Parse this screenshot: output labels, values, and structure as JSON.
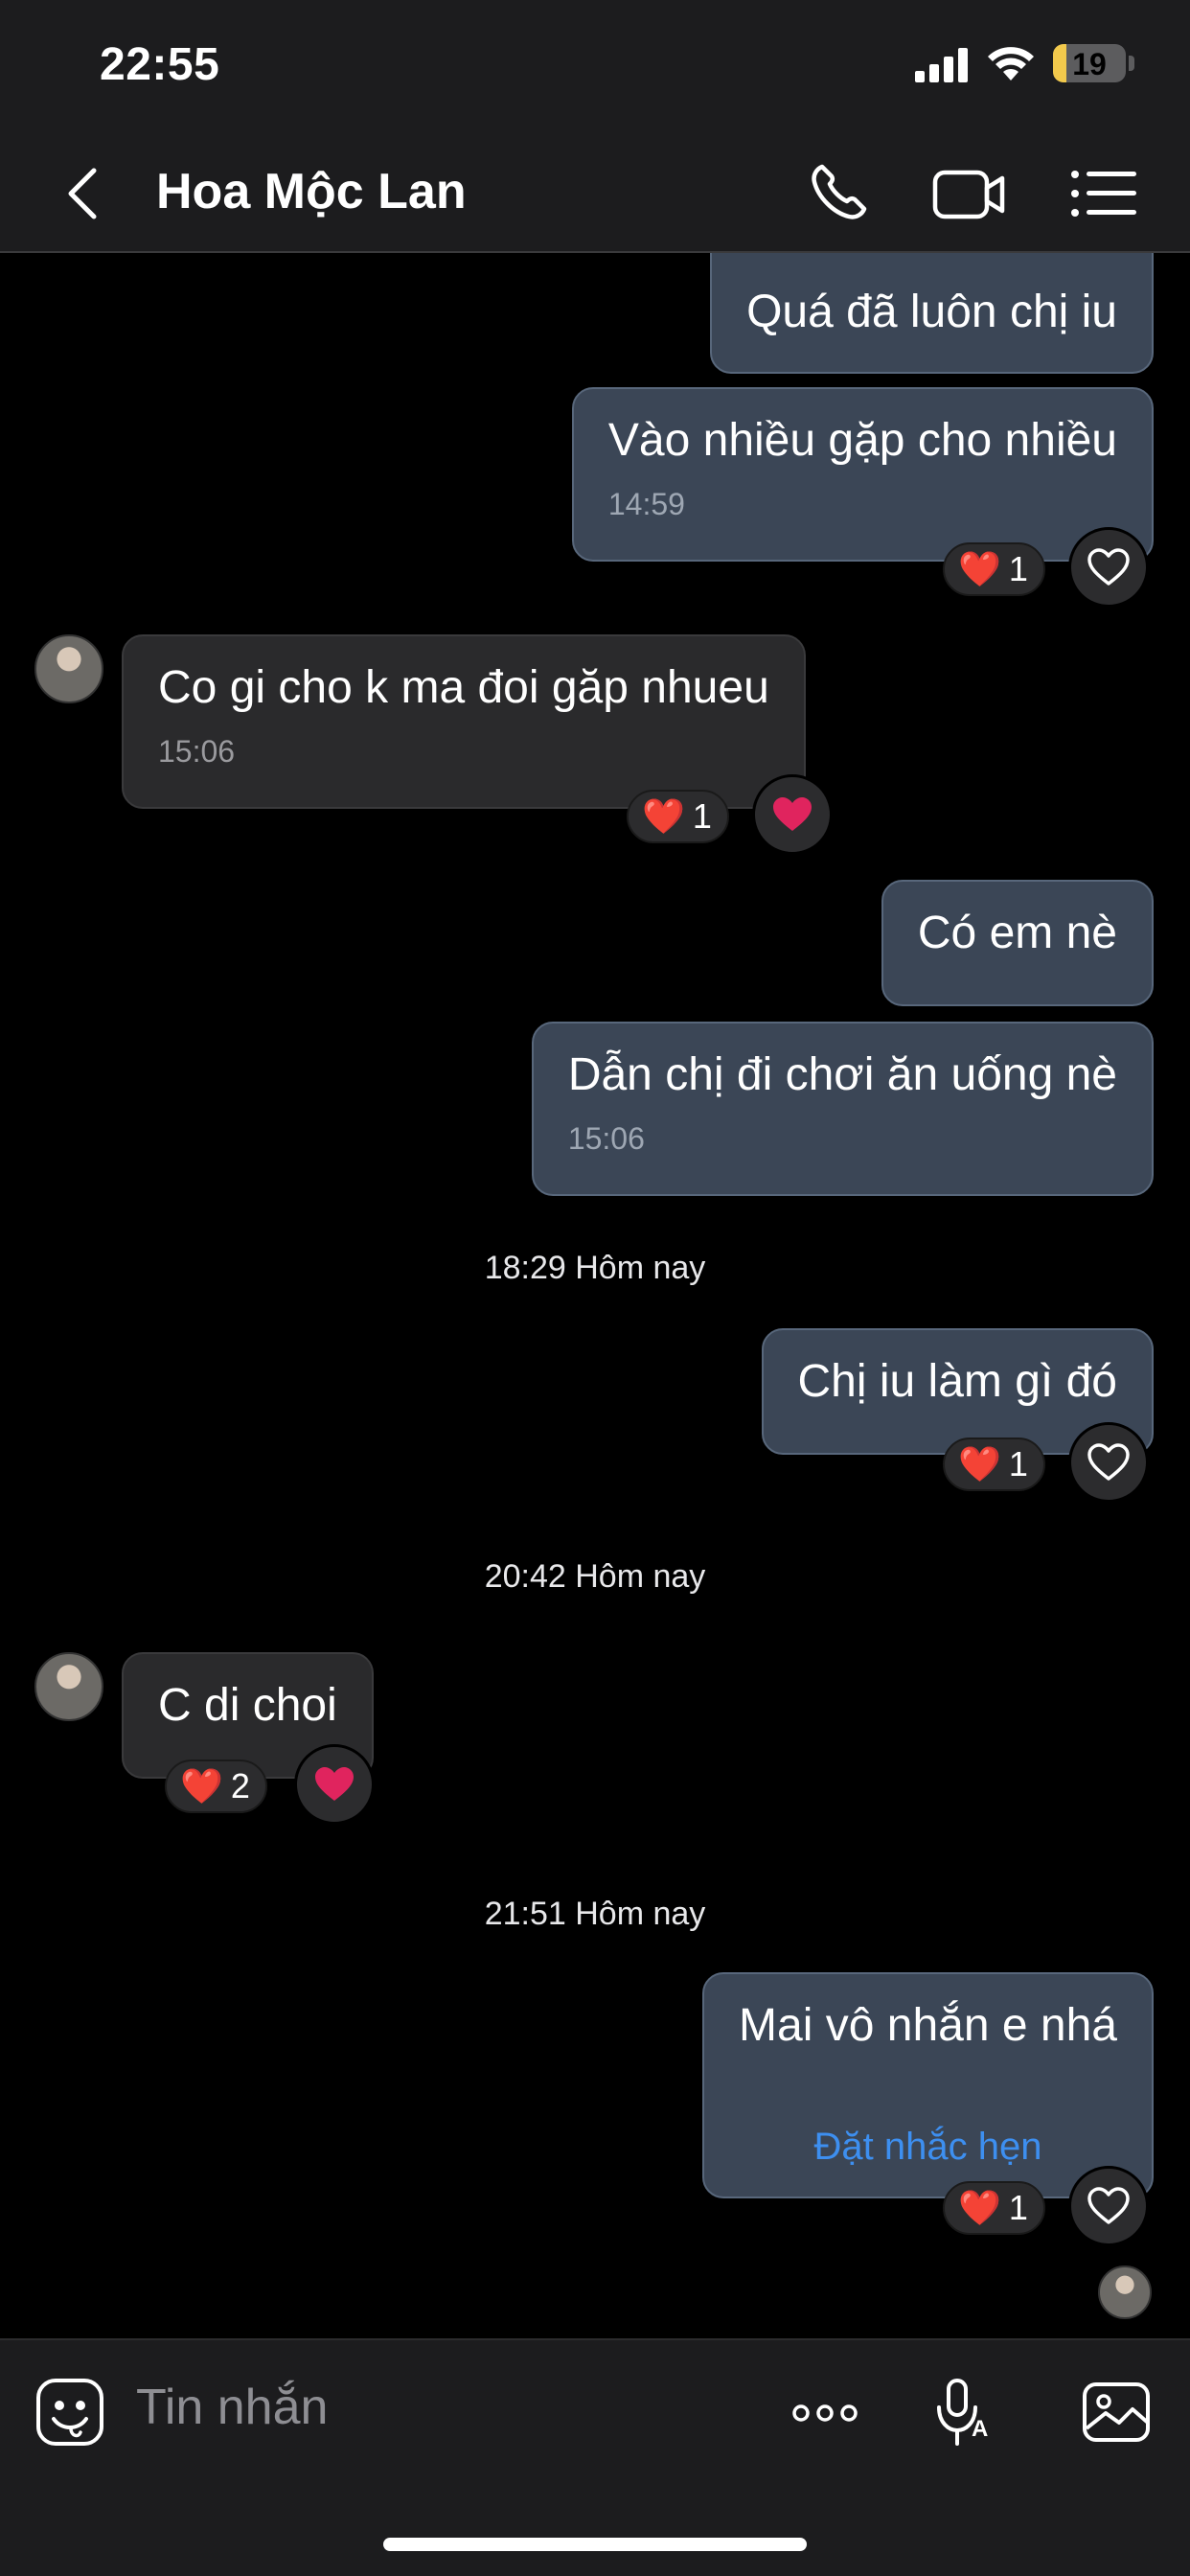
{
  "status_bar": {
    "time": "22:55",
    "battery": "19",
    "battery_level": 0.19,
    "battery_color": "#f2c94c"
  },
  "header": {
    "contact_name": "Hoa Mộc Lan",
    "icons": [
      "back-icon",
      "phone-icon",
      "video-call-icon",
      "menu-list-icon"
    ]
  },
  "messages": [
    {
      "id": "m1",
      "direction": "out",
      "text": "Quá đã luôn chị iu"
    },
    {
      "id": "m2",
      "direction": "out",
      "text": "Vào nhiều gặp cho nhiều",
      "time": "14:59",
      "reaction": {
        "emoji": "❤️",
        "count": "1"
      }
    },
    {
      "id": "m3",
      "direction": "in",
      "text": "Co gi cho k ma đoi găp nhueu",
      "time": "15:06",
      "reaction": {
        "emoji": "❤️",
        "count": "1"
      }
    },
    {
      "id": "m4",
      "direction": "out",
      "text": "Có em nè"
    },
    {
      "id": "m5",
      "direction": "out",
      "text": "Dẫn chị đi chơi ăn uống nè",
      "time": "15:06"
    },
    {
      "id": "m6",
      "direction": "out",
      "text": "Chị iu làm gì đó",
      "reaction": {
        "emoji": "❤️",
        "count": "1"
      }
    },
    {
      "id": "m7",
      "direction": "in",
      "text": "C di choi",
      "reaction": {
        "emoji": "❤️",
        "count": "2"
      }
    },
    {
      "id": "m8",
      "direction": "out",
      "text": "Mai vô nhắn e nhá",
      "reminder_link": "Đặt nhắc hẹn",
      "reaction": {
        "emoji": "❤️",
        "count": "1"
      }
    }
  ],
  "dividers": [
    "18:29 Hôm nay",
    "20:42 Hôm nay",
    "21:51 Hôm nay"
  ],
  "composer": {
    "placeholder": "Tin nhắn",
    "icons": [
      "sticker-icon",
      "more-icon",
      "voice-icon",
      "image-icon"
    ]
  },
  "colors": {
    "outgoing_bubble": "#3b4656",
    "incoming_bubble": "#2a2a2c",
    "link": "#3d8ff0",
    "heart": "#e0245e"
  }
}
